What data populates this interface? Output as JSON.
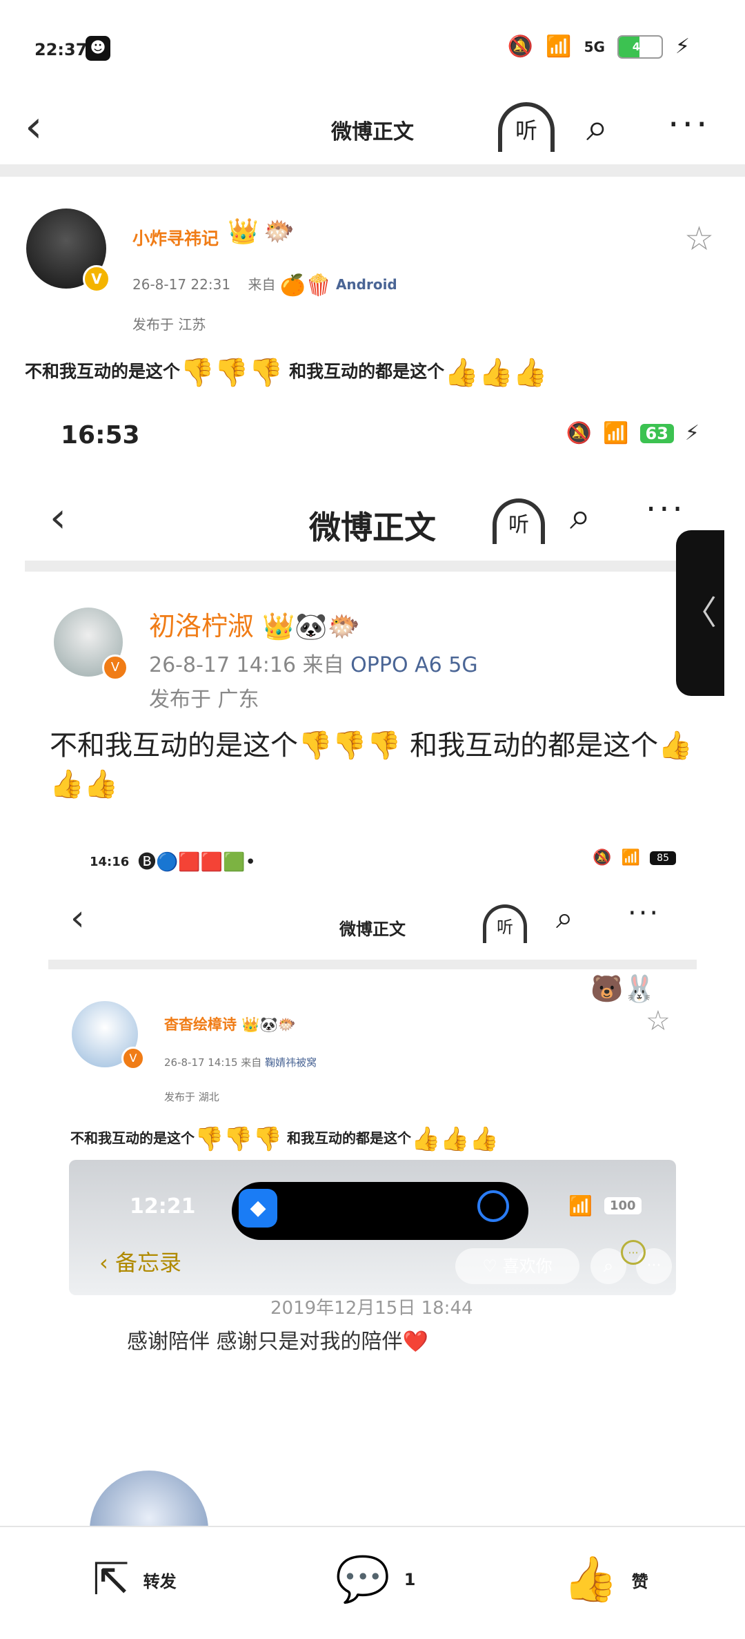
{
  "status_bar": {
    "time": "22:37",
    "network": "5G",
    "battery": "48",
    "battery_level": 0.48
  },
  "nav": {
    "title": "微博正文",
    "listen_label": "听"
  },
  "post": {
    "username": "小炸寻祎记",
    "date": "26-8-17 22:31",
    "source_prefix": "来自",
    "source": "Android",
    "location": "发布于 江苏",
    "text_a": "不和我互动的是这个",
    "text_b": "和我互动的都是这个",
    "emoji_down": "👎👎👎",
    "emoji_up": "👍👍👍"
  },
  "shot1": {
    "time": "16:53",
    "battery": "63",
    "title": "微博正文",
    "listen_label": "听",
    "username": "初洛柠淑",
    "meta": "26-8-17 14:16  来自",
    "source": "OPPO A6 5G",
    "location": "发布于 广东",
    "text_a": "不和我互动的是这个",
    "text_b": "和我互动的都是这个",
    "emoji_down": "👎👎👎",
    "emoji_up": "👍👍👍"
  },
  "shot2": {
    "time": "14:16",
    "battery": "85",
    "title": "微博正文",
    "listen_label": "听",
    "username": "杳杳绘樟诗",
    "meta": "26-8-17 14:15  来自",
    "source": "鞠婧祎被窝",
    "location": "发布于 湖北",
    "text_a": "不和我互动的是这个",
    "text_b": "和我互动的都是这个",
    "emoji_down": "👎👎👎",
    "emoji_up": "👍👍👍"
  },
  "shot3": {
    "time": "12:21",
    "battery": "100",
    "back_label": "备忘录",
    "like_label": "喜欢你",
    "date": "2019年12月15日 18:44",
    "memo_text": "感谢陪伴 感谢只是对我的陪伴❤️"
  },
  "bottom_bar": {
    "repost_label": "转发",
    "comment_count": "1",
    "like_label": "赞"
  },
  "icons": [
    "back-arrow-icon",
    "listen-icon",
    "search-icon",
    "more-icon",
    "star-icon",
    "repost-icon",
    "comment-icon",
    "like-icon"
  ]
}
